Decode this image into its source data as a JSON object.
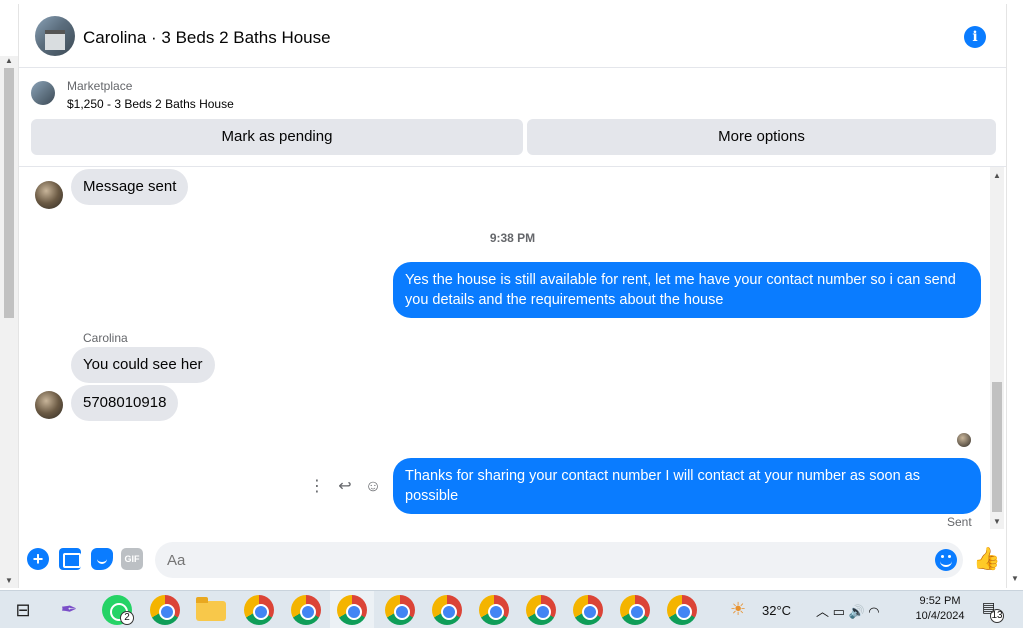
{
  "header": {
    "title": "Carolina · 3 Beds 2 Baths House"
  },
  "marketplace": {
    "label": "Marketplace",
    "listing": "$1,250 - 3 Beds 2 Baths House",
    "buttons": {
      "pending": "Mark as pending",
      "more": "More options"
    }
  },
  "messages": {
    "m1": "Message sent",
    "time": "9:38 PM",
    "m2": "Yes the house is still available for rent, let me have your contact number so i can send you details and the requirements about the house",
    "sender": "Carolina",
    "m3": "You could see her",
    "m4": "5708010918",
    "m5": "Thanks for sharing your contact number I will contact at your number as soon as possible",
    "status": "Sent"
  },
  "composer": {
    "placeholder": "Aa",
    "gif_label": "GIF"
  },
  "taskbar": {
    "whatsapp_badge": "2",
    "temperature": "32°C",
    "time": "9:52 PM",
    "date": "10/4/2024",
    "notifications": "13"
  },
  "colors": {
    "accent": "#0a7cff",
    "bubble_in": "#e4e6eb"
  }
}
